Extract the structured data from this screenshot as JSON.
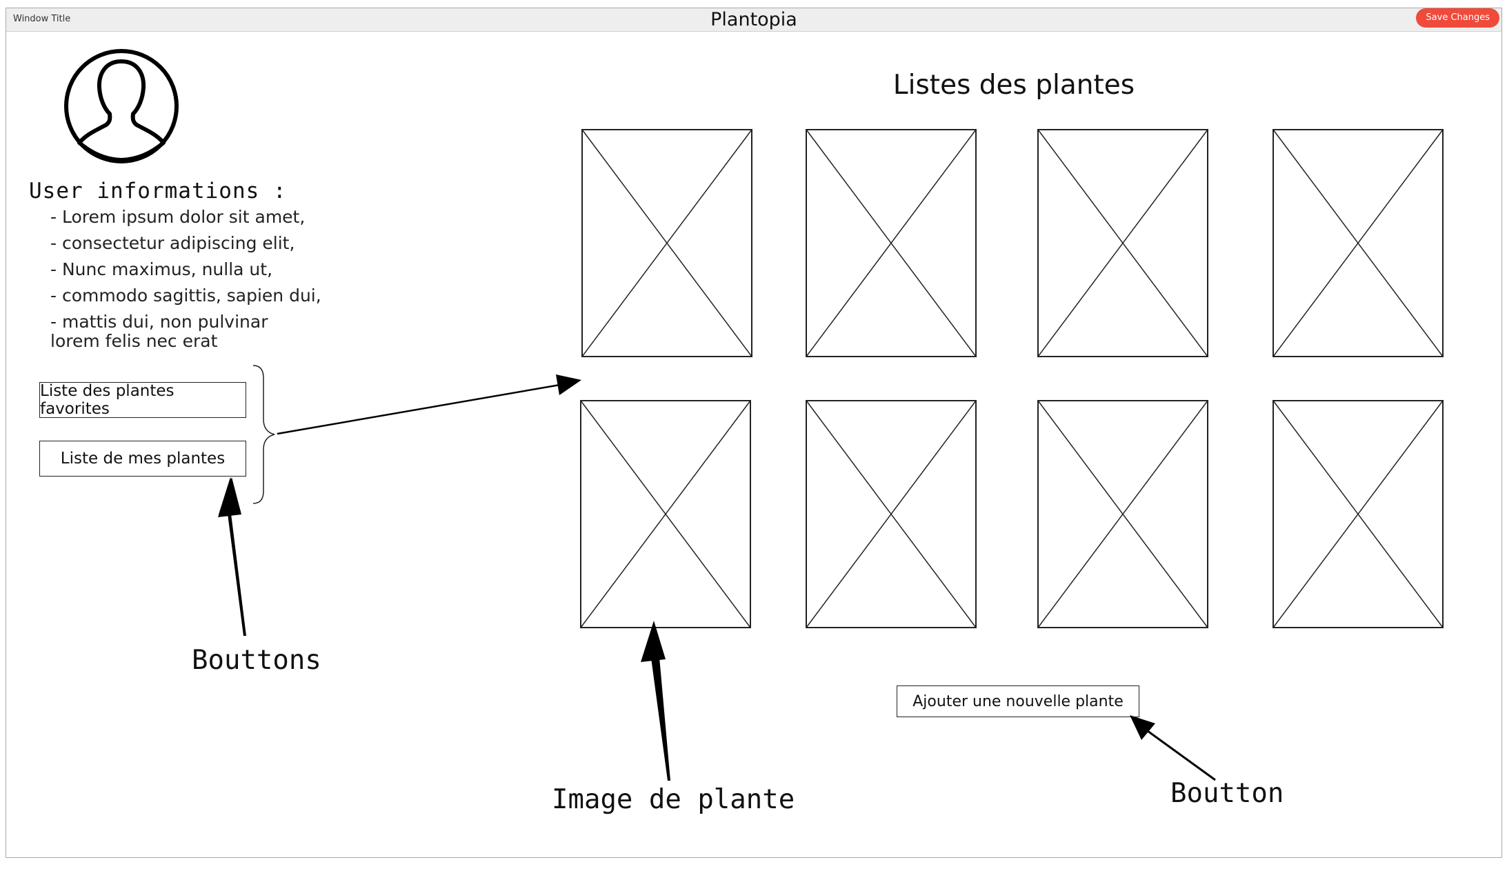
{
  "window": {
    "title_label": "Window Title",
    "app_title": "Plantopia",
    "save_button": "Save Changes"
  },
  "user": {
    "heading": "User informations :",
    "lines": [
      "- Lorem ipsum dolor sit amet,",
      "- consectetur adipiscing elit,",
      "- Nunc maximus, nulla ut,",
      "- commodo sagittis, sapien dui,",
      "- mattis dui, non pulvinar lorem felis nec erat"
    ]
  },
  "sidebar": {
    "favorites_button": "Liste des plantes favorites",
    "mine_button": "Liste de mes plantes"
  },
  "main": {
    "title": "Listes des plantes",
    "add_button": "Ajouter une nouvelle plante"
  },
  "annotations": {
    "buttons": "Bouttons",
    "image": "Image de plante",
    "button": "Boutton"
  },
  "icons": {
    "avatar": "user-avatar-icon",
    "placeholder": "image-placeholder-icon"
  },
  "colors": {
    "save_button": "#f04a3a",
    "titlebar": "#eeeeee"
  }
}
